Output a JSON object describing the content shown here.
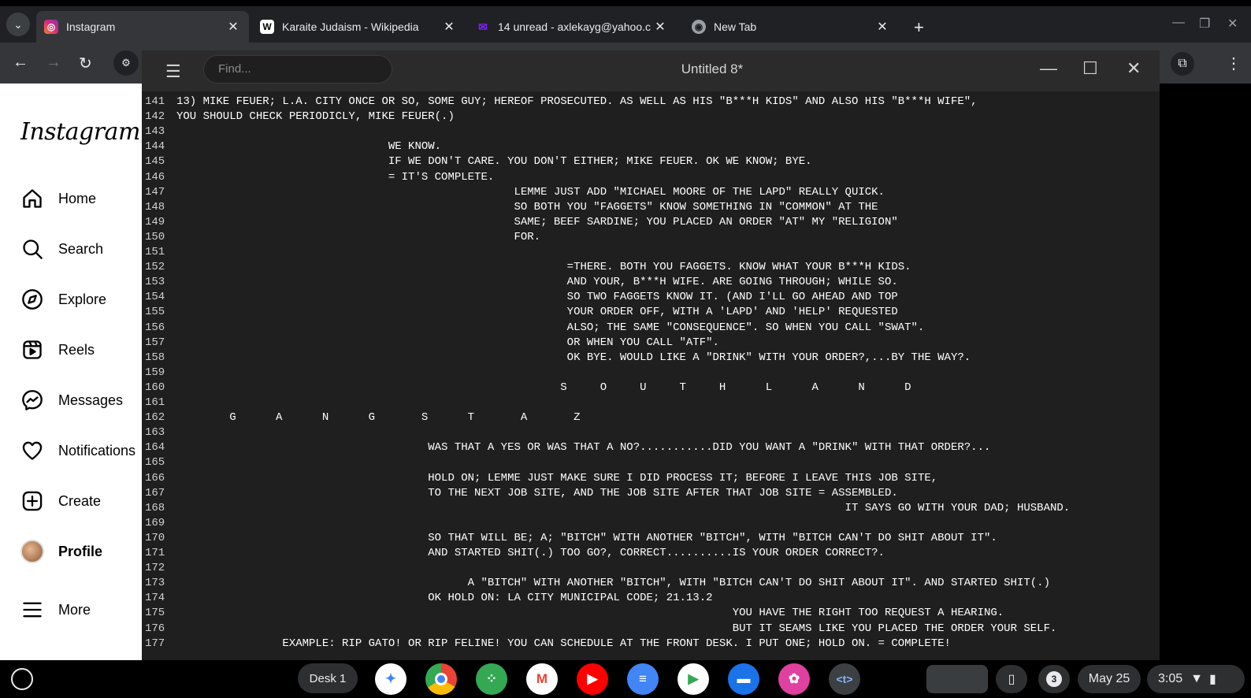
{
  "browser": {
    "tabs": [
      {
        "title": "Instagram",
        "icon": "instagram-icon",
        "active": true
      },
      {
        "title": "Karaite Judaism - Wikipedia",
        "icon": "wikipedia-icon",
        "active": false
      },
      {
        "title": "14 unread - axlekayg@yahoo.c",
        "icon": "mail-icon",
        "active": false
      },
      {
        "title": "New Tab",
        "icon": "chrome-icon",
        "active": false
      }
    ],
    "new_tab_label": "+"
  },
  "instagram": {
    "logo": "Instagram",
    "nav": [
      {
        "label": "Home",
        "icon": "home-icon"
      },
      {
        "label": "Search",
        "icon": "search-icon"
      },
      {
        "label": "Explore",
        "icon": "compass-icon"
      },
      {
        "label": "Reels",
        "icon": "reels-icon"
      },
      {
        "label": "Messages",
        "icon": "messenger-icon"
      },
      {
        "label": "Notifications",
        "icon": "heart-icon"
      },
      {
        "label": "Create",
        "icon": "plus-square-icon"
      },
      {
        "label": "Profile",
        "icon": "avatar"
      },
      {
        "label": "More",
        "icon": "hamburger-icon"
      }
    ]
  },
  "editor": {
    "find_placeholder": "Find...",
    "title": "Untitled 8*",
    "lines": [
      {
        "n": "141",
        "t": "13) MIKE FEUER; L.A. CITY ONCE OR SO, SOME GUY; HEREOF PROSECUTED. AS WELL AS HIS \"B***H KIDS\" AND ALSO HIS \"B***H WIFE\","
      },
      {
        "n": "142",
        "t": "YOU SHOULD CHECK PERIODICLY, MIKE FEUER(.)"
      },
      {
        "n": "143",
        "t": ""
      },
      {
        "n": "144",
        "t": "                                WE KNOW."
      },
      {
        "n": "145",
        "t": "                                IF WE DON'T CARE. YOU DON'T EITHER; MIKE FEUER. OK WE KNOW; BYE."
      },
      {
        "n": "146",
        "t": "                                = IT'S COMPLETE."
      },
      {
        "n": "147",
        "t": "                                                   LEMME JUST ADD \"MICHAEL MOORE OF THE LAPD\" REALLY QUICK."
      },
      {
        "n": "148",
        "t": "                                                   SO BOTH YOU \"FAGGETS\" KNOW SOMETHING IN \"COMMON\" AT THE"
      },
      {
        "n": "149",
        "t": "                                                   SAME; BEEF SARDINE; YOU PLACED AN ORDER \"AT\" MY \"RELIGION\""
      },
      {
        "n": "150",
        "t": "                                                   FOR."
      },
      {
        "n": "151",
        "t": ""
      },
      {
        "n": "152",
        "t": "                                                           =THERE. BOTH YOU FAGGETS. KNOW WHAT YOUR B***H KIDS."
      },
      {
        "n": "153",
        "t": "                                                           AND YOUR, B***H WIFE. ARE GOING THROUGH; WHILE SO."
      },
      {
        "n": "154",
        "t": "                                                           SO TWO FAGGETS KNOW IT. (AND I'LL GO AHEAD AND TOP"
      },
      {
        "n": "155",
        "t": "                                                           YOUR ORDER OFF, WITH A 'LAPD' AND 'HELP' REQUESTED"
      },
      {
        "n": "156",
        "t": "                                                           ALSO; THE SAME \"CONSEQUENCE\". SO WHEN YOU CALL \"SWAT\"."
      },
      {
        "n": "157",
        "t": "                                                           OR WHEN YOU CALL \"ATF\"."
      },
      {
        "n": "158",
        "t": "                                                           OK BYE. WOULD LIKE A \"DRINK\" WITH YOUR ORDER?,...BY THE WAY?."
      },
      {
        "n": "159",
        "t": ""
      },
      {
        "n": "160",
        "t": "                                                          S     O     U     T     H      L      A      N      D"
      },
      {
        "n": "161",
        "t": ""
      },
      {
        "n": "162",
        "t": "        G      A      N      G       S      T       A       Z"
      },
      {
        "n": "163",
        "t": ""
      },
      {
        "n": "164",
        "t": "                                      WAS THAT A YES OR WAS THAT A NO?...........DID YOU WANT A \"DRINK\" WITH THAT ORDER?..."
      },
      {
        "n": "165",
        "t": ""
      },
      {
        "n": "166",
        "t": "                                      HOLD ON; LEMME JUST MAKE SURE I DID PROCESS IT; BEFORE I LEAVE THIS JOB SITE,"
      },
      {
        "n": "167",
        "t": "                                      TO THE NEXT JOB SITE, AND THE JOB SITE AFTER THAT JOB SITE = ASSEMBLED."
      },
      {
        "n": "168",
        "t": "                                                                                                     IT SAYS GO WITH YOUR DAD; HUSBAND."
      },
      {
        "n": "169",
        "t": ""
      },
      {
        "n": "170",
        "t": "                                      SO THAT WILL BE; A; \"BITCH\" WITH ANOTHER \"BITCH\", WITH \"BITCH CAN'T DO SHIT ABOUT IT\"."
      },
      {
        "n": "171",
        "t": "                                      AND STARTED SHIT(.) TOO GO?, CORRECT..........IS YOUR ORDER CORRECT?."
      },
      {
        "n": "172",
        "t": ""
      },
      {
        "n": "173",
        "t": "                                            A \"BITCH\" WITH ANOTHER \"BITCH\", WITH \"BITCH CAN'T DO SHIT ABOUT IT\". AND STARTED SHIT(.)"
      },
      {
        "n": "174",
        "t": "                                      OK HOLD ON: LA CITY MUNICIPAL CODE; 21.13.2"
      },
      {
        "n": "175",
        "t": "                                                                                    YOU HAVE THE RIGHT TOO REQUEST A HEARING."
      },
      {
        "n": "176",
        "t": "                                                                                    BUT IT SEAMS LIKE YOU PLACED THE ORDER YOUR SELF."
      },
      {
        "n": "177",
        "t": "                EXAMPLE: RIP GATO! OR RIP FELINE! YOU CAN SCHEDULE AT THE FRONT DESK. I PUT ONE; HOLD ON. = COMPLETE!"
      }
    ]
  },
  "shelf": {
    "desk_label": "Desk 1",
    "apps": [
      {
        "name": "gemini-icon",
        "color": "#ffffff"
      },
      {
        "name": "chrome-icon",
        "color": "#ea4335"
      },
      {
        "name": "apps-icon",
        "color": "#34a853"
      },
      {
        "name": "gmail-icon",
        "color": "#ffffff"
      },
      {
        "name": "youtube-icon",
        "color": "#ff0000"
      },
      {
        "name": "docs-icon",
        "color": "#4285f4"
      },
      {
        "name": "play-store-icon",
        "color": "#ffffff"
      },
      {
        "name": "files-icon",
        "color": "#1a73e8"
      },
      {
        "name": "gallery-icon",
        "color": "#e040a0"
      },
      {
        "name": "text-editor-icon",
        "color": "#3c4043"
      }
    ],
    "notification_count": "3",
    "date": "May 25",
    "time": "3:05"
  }
}
